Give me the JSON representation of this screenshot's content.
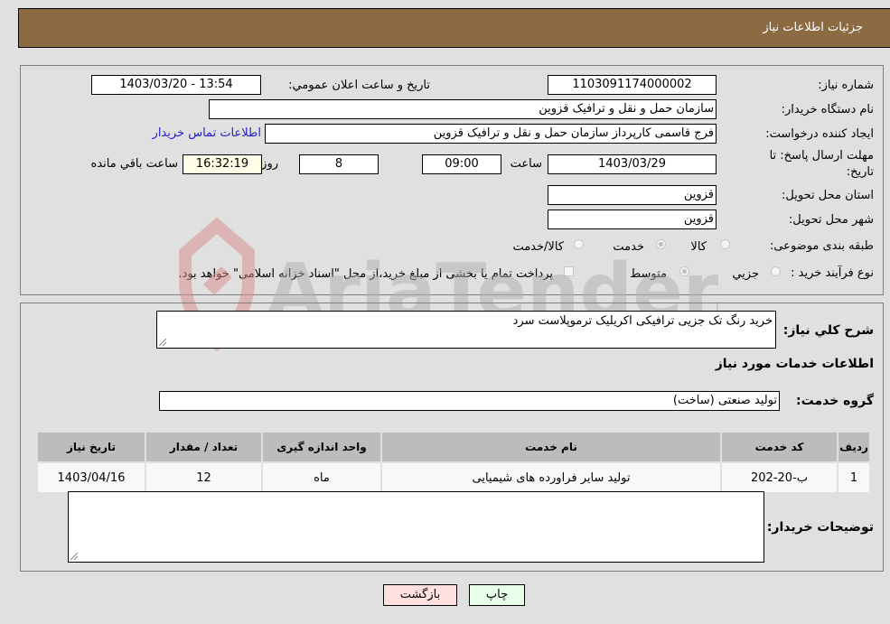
{
  "header": {
    "title": "جزئیات اطلاعات نیاز"
  },
  "form": {
    "need_number": {
      "label": "شماره نیاز:",
      "value": "1103091174000002"
    },
    "announce": {
      "label": "تاریخ و ساعت اعلان عمومي:",
      "value": "1403/03/20 - 13:54"
    },
    "buyer_org": {
      "label": "نام دستگاه خریدار:",
      "value": "سازمان حمل و نقل و ترافیک قزوین"
    },
    "creator": {
      "label": "ایجاد کننده درخواست:",
      "value": "فرج قاسمی کارپرداز سازمان حمل و نقل و ترافیک قزوین",
      "link": "اطلاعات تماس خریدار"
    },
    "deadline": {
      "label_line1": "مهلت ارسال پاسخ: تا",
      "label_line2": "تاریخ:",
      "date": "1403/03/29",
      "time_label": "ساعت",
      "time": "09:00",
      "days": "8",
      "days_label": "روز و",
      "remaining": "16:32:19",
      "remaining_label": "ساعت باقي مانده"
    },
    "province": {
      "label": "استان محل تحویل:",
      "value": "قزوین"
    },
    "city": {
      "label": "شهر محل تحویل:",
      "value": "قزوین"
    },
    "category": {
      "label": "طبقه بندی موضوعی:",
      "options": [
        "کالا",
        "خدمت",
        "کالا/خدمت"
      ],
      "selected": "خدمت"
    },
    "process": {
      "label": "نوع فرآیند خرید :",
      "options": [
        "جزيي",
        "متوسط"
      ],
      "selected": "متوسط",
      "checkbox_label": "پرداخت تمام یا بخشی از مبلغ خرید،از محل \"اسناد خزانه اسلامی\" خواهد بود."
    }
  },
  "details": {
    "summary_label": "شرح کلي نياز:",
    "summary_value": "خرید رنگ تک جزیی ترافیکی اکریلیک ترموپلاست سرد",
    "services_heading": "اطلاعات خدمات مورد نياز",
    "service_group_label": "گروه خدمت:",
    "service_group_value": "تولید صنعتی (ساخت)",
    "table": {
      "headers": [
        "رديف",
        "کد خدمت",
        "نام خدمت",
        "واحد اندازه گیری",
        "تعداد / مقدار",
        "تاریخ نیاز"
      ],
      "rows": [
        [
          "1",
          "ب-20-202",
          "تولید سایر فراورده های شیمیایی",
          "ماه",
          "12",
          "1403/04/16"
        ]
      ]
    },
    "buyer_notes_label": "توضیحات خریدار:",
    "buyer_notes_value": ""
  },
  "buttons": {
    "print": "چاپ",
    "back": "بازگشت"
  },
  "watermark": {
    "text": "AriaTender.neT"
  },
  "colors": {
    "header_bg": "#8c6b42",
    "page_bg": "#e0e0e0",
    "link": "#2222cc",
    "print_bg": "#e8ffe8",
    "back_bg": "#ffe0e0"
  }
}
